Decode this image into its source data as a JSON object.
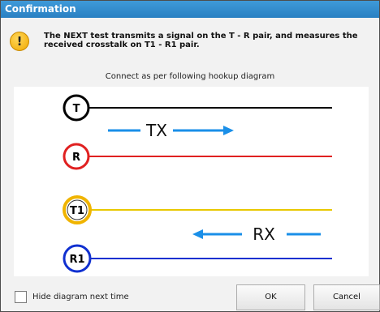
{
  "dialog": {
    "title": "Confirmation",
    "message": "The NEXT test transmits a signal on the T - R pair, and measures the received crosstalk on T1 - R1 pair.",
    "instruction": "Connect as per following hookup diagram",
    "warning_icon": "exclamation-icon"
  },
  "diagram": {
    "terminals": [
      {
        "label": "T",
        "ring_color": "#000000",
        "line_color": "#000000"
      },
      {
        "label": "R",
        "ring_color": "#e02020",
        "line_color": "#e02020"
      },
      {
        "label": "T1",
        "ring_color": "#f0b400",
        "line_color": "#e8c800"
      },
      {
        "label": "R1",
        "ring_color": "#1030d0",
        "line_color": "#1030d0"
      }
    ],
    "tx_label": "TX",
    "rx_label": "RX",
    "arrow_color": "#1a8fe8"
  },
  "footer": {
    "checkbox_label": "Hide diagram next time",
    "checkbox_checked": false,
    "ok_label": "OK",
    "cancel_label": "Cancel"
  }
}
